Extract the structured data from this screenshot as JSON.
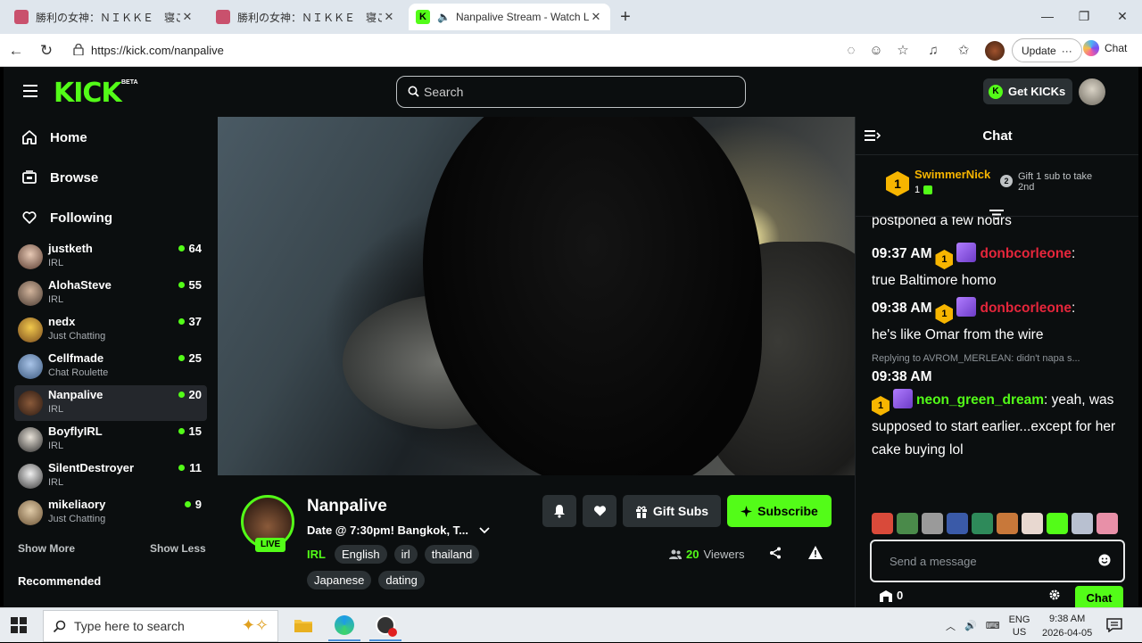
{
  "browser": {
    "tabs": [
      {
        "title": "勝利の女神：ＮＩＫＫＥ　寝ころび",
        "active": false
      },
      {
        "title": "勝利の女神：ＮＩＫＫＥ　寝ころび",
        "active": false
      },
      {
        "title": "Nanpalive Stream - Watch Live",
        "active": true
      }
    ],
    "url": "https://kick.com/nanpalive",
    "update_label": "Update",
    "chat_label": "Chat"
  },
  "header": {
    "logo": "KICK",
    "beta": "BETA",
    "search_placeholder": "Search",
    "get_kicks": "Get KICKs"
  },
  "sidebar": {
    "nav": [
      {
        "label": "Home",
        "icon": "home-icon"
      },
      {
        "label": "Browse",
        "icon": "browse-icon"
      },
      {
        "label": "Following",
        "icon": "heart-icon"
      }
    ],
    "channels": [
      {
        "name": "justketh",
        "category": "IRL",
        "viewers": "64"
      },
      {
        "name": "AlohaSteve",
        "category": "IRL",
        "viewers": "55"
      },
      {
        "name": "nedx",
        "category": "Just Chatting",
        "viewers": "37"
      },
      {
        "name": "Cellfmade",
        "category": "Chat Roulette",
        "viewers": "25"
      },
      {
        "name": "Nanpalive",
        "category": "IRL",
        "viewers": "20"
      },
      {
        "name": "BoyflyIRL",
        "category": "IRL",
        "viewers": "15"
      },
      {
        "name": "SilentDestroyer",
        "category": "IRL",
        "viewers": "11"
      },
      {
        "name": "mikeliaory",
        "category": "Just Chatting",
        "viewers": "9"
      }
    ],
    "show_more": "Show More",
    "show_less": "Show Less",
    "recommended": "Recommended"
  },
  "stream": {
    "channel_name": "Nanpalive",
    "live_badge": "LIVE",
    "title": "Date @ 7:30pm! Bangkok, T...",
    "category": "IRL",
    "tags": [
      "English",
      "irl",
      "thailand",
      "Japanese",
      "dating"
    ],
    "gift_subs": "Gift Subs",
    "subscribe": "Subscribe",
    "viewer_count": "20",
    "viewers_label": "Viewers"
  },
  "chat": {
    "title": "Chat",
    "pinned": {
      "badge": "1",
      "user": "SwimmerNick",
      "count": "1",
      "gift_badge": "2",
      "gift_text": "Gift 1 sub to take 2nd"
    },
    "partial_line": "postponed a few hours",
    "messages": [
      {
        "time": "09:37 AM",
        "badge": "1",
        "user": "donbcorleone",
        "user_color": "#e5263b",
        "text": "true Baltimore homo"
      },
      {
        "time": "09:38 AM",
        "badge": "1",
        "user": "donbcorleone",
        "user_color": "#e5263b",
        "text": "he's like Omar from the wire"
      },
      {
        "time": "09:38 AM",
        "badge": "1",
        "user": "neon_green_dream",
        "user_color": "#53fc18",
        "text": "yeah, was supposed to start earlier...except for her cake buying lol",
        "reply": "Replying to AVROM_MERLEAN: didn't napa s..."
      }
    ],
    "input_placeholder": "Send a message",
    "points": "0",
    "send_label": "Chat"
  },
  "taskbar": {
    "search_placeholder": "Type here to search",
    "lang": "ENG",
    "region": "US",
    "time": "9:38 AM",
    "date": "2026-04-05"
  }
}
